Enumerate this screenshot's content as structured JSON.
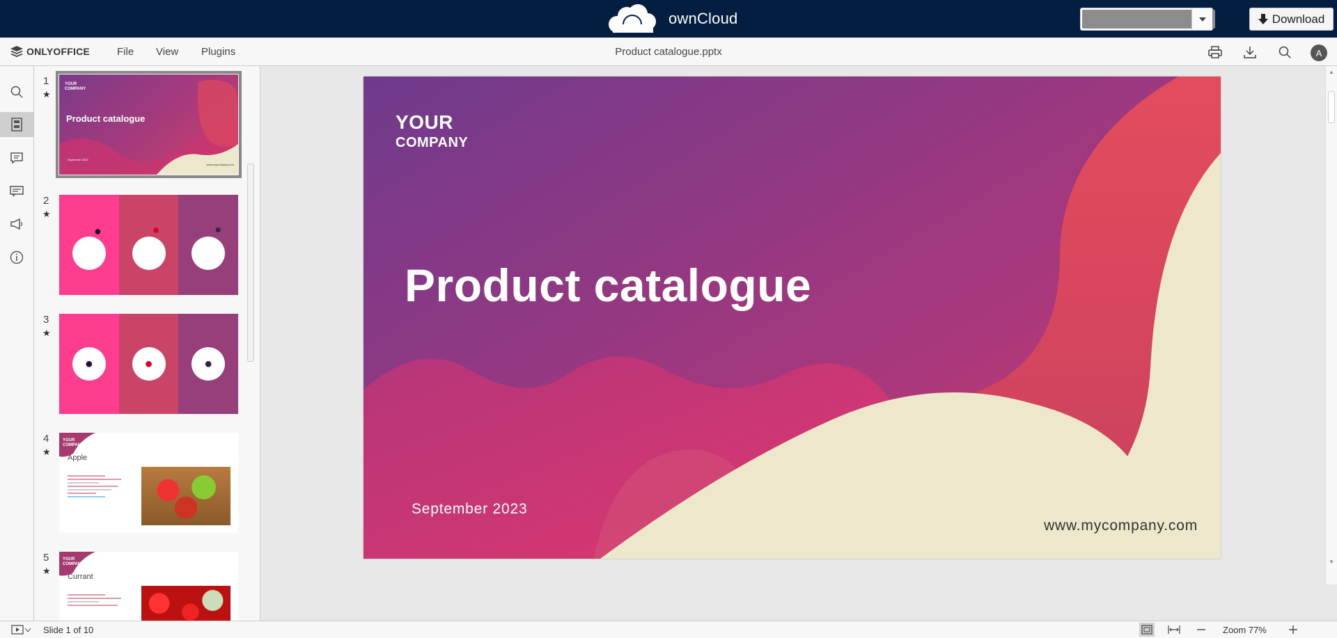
{
  "owncloud": {
    "brand": "ownCloud",
    "download_label": "Download"
  },
  "editor": {
    "app_name": "ONLYOFFICE",
    "menu": [
      "File",
      "View",
      "Plugins"
    ],
    "doc_title": "Product catalogue.pptx",
    "avatar_letter": "A"
  },
  "thumbnails": [
    {
      "num": "1",
      "title": "Product catalogue",
      "company": "YOUR",
      "company2": "COMPANY",
      "date": "September 2023",
      "url": "www.mycompany.com"
    },
    {
      "num": "2"
    },
    {
      "num": "3"
    },
    {
      "num": "4",
      "company": "YOUR",
      "company2": "COMPANY",
      "heading": "Apple"
    },
    {
      "num": "5",
      "company": "YOUR",
      "company2": "COMPANY",
      "heading": "Currant"
    }
  ],
  "slide": {
    "company_line1": "YOUR",
    "company_line2": "COMPANY",
    "title": "Product catalogue",
    "date": "September 2023",
    "url": "www.mycompany.com"
  },
  "status": {
    "slide_info": "Slide 1 of 10",
    "zoom": "Zoom 77%"
  },
  "colors": {
    "oc_bar": "#041e42",
    "slide_purple": "#7a3b8a",
    "slide_magenta": "#c93a76",
    "slide_red": "#d64560",
    "slide_cream": "#ede7cb"
  }
}
